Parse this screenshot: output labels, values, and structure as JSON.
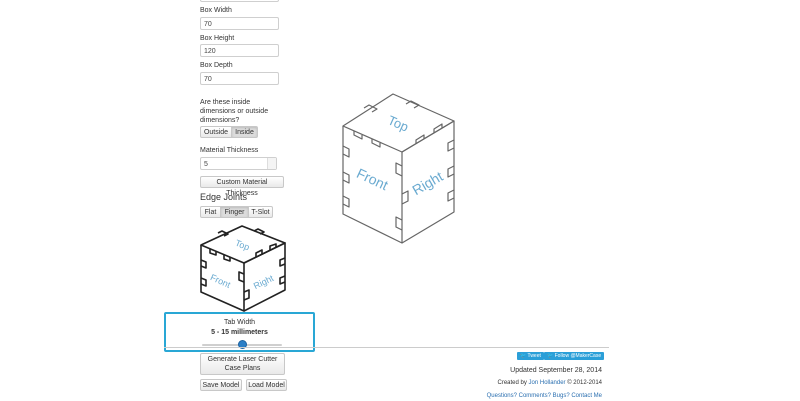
{
  "form": {
    "box_width_label": "Box Width",
    "box_width_value": "70",
    "box_height_label": "Box Height",
    "box_height_value": "120",
    "box_depth_label": "Box Depth",
    "box_depth_value": "70",
    "dimensions_question": "Are these inside dimensions or outside dimensions?",
    "dimension_options": [
      "Outside",
      "Inside"
    ],
    "dimension_selected": "Inside",
    "material_thickness_label": "Material Thickness",
    "material_thickness_value": "5",
    "custom_thickness_button": "Custom Material Thickness",
    "edge_joints_heading": "Edge Joints",
    "edge_joint_options": [
      "Flat",
      "Finger",
      "T-Slot"
    ],
    "edge_joint_selected": "Finger"
  },
  "preview": {
    "face_labels": {
      "top": "Top",
      "front": "Front",
      "right": "Right"
    }
  },
  "tab_width": {
    "label": "Tab Width",
    "range_text": "5 - 15 millimeters",
    "slider_fraction": 0.5,
    "highlight_color": "#29a7d5"
  },
  "actions": {
    "generate_button": "Generate Laser Cutter Case Plans",
    "save_button": "Save Model",
    "load_button": "Load Model"
  },
  "footer": {
    "tweet_button": "Tweet",
    "follow_button": "Follow @MakerCase",
    "updated_text": "Updated September 28, 2014",
    "created_prefix": "Created by ",
    "author_link": "Jon Hollander",
    "copyright_text": " © 2012-2014",
    "contact_link": "Questions? Comments? Bugs? Contact Me"
  },
  "colors": {
    "accent": "#29a7d5",
    "link": "#2a6fb0",
    "twitter": "#2b9fd8",
    "face_text": "#6aaad0"
  }
}
